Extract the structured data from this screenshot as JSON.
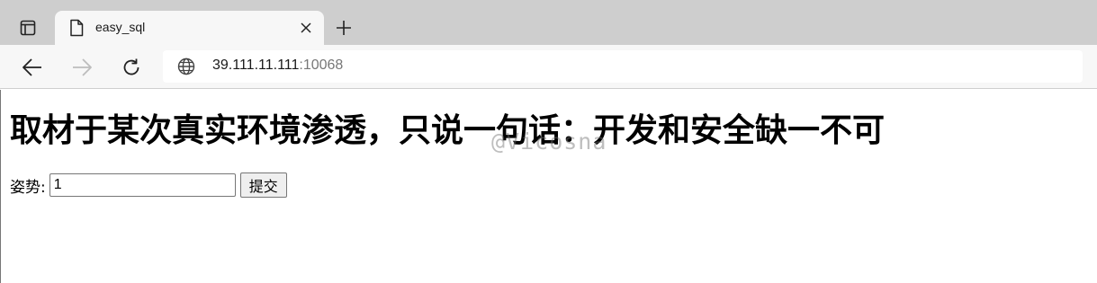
{
  "browser": {
    "tab": {
      "title": "easy_sql"
    },
    "address": {
      "host": "39.111.11.111",
      "port": ":10068"
    }
  },
  "page": {
    "heading": "取材于某次真实环境渗透，只说一句话：开发和安全缺一不可",
    "watermark": "@Vicosna",
    "form": {
      "label": "姿势:",
      "input_value": "1",
      "submit_label": "提交"
    }
  },
  "icons": {
    "tab_actions": "tab-actions-icon",
    "favicon": "page-icon",
    "close": "close-icon",
    "new_tab": "plus-icon",
    "back": "back-arrow-icon",
    "forward": "forward-arrow-icon",
    "refresh": "refresh-icon",
    "site": "globe-icon"
  }
}
